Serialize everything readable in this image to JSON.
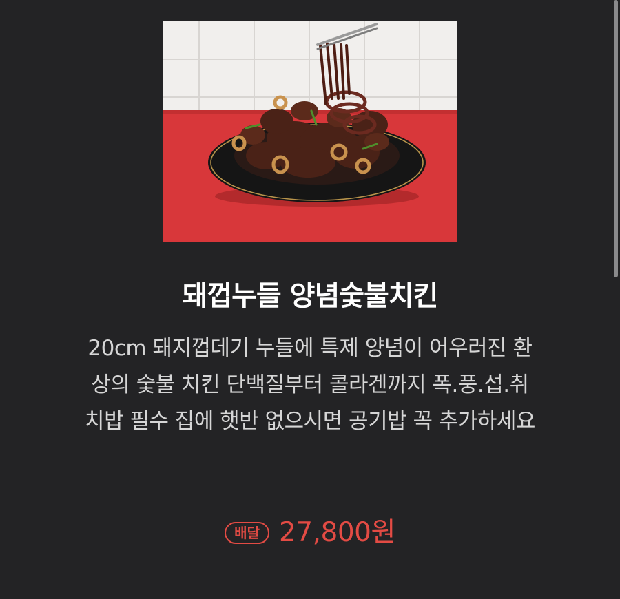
{
  "product": {
    "image_alt": "돼껍누들 양념숯불치킨 image",
    "title": "돼껍누들 양념숯불치킨",
    "description": "20cm 돼지껍데기 누들에 특제 양념이 어우러진 환상의 숯불 치킨 단백질부터 콜라겐까지 폭.풍.섭.취 치밥 필수 집에 햇반 없으시면 공기밥 꼭 추가하세요",
    "price_badge": "배달",
    "price": "27,800원"
  },
  "colors": {
    "background": "#232325",
    "accent": "#e34b44",
    "title": "#ffffff",
    "description": "#d6d6d6"
  }
}
